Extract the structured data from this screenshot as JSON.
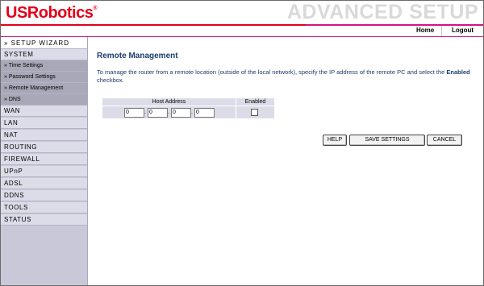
{
  "header": {
    "logo_text": "USRobotics",
    "logo_mark": "®",
    "banner": "ADVANCED SETUP",
    "accent_red": "#e3001b",
    "accent_magenta": "#d8127e"
  },
  "topnav": {
    "home": "Home",
    "logout": "Logout"
  },
  "sidebar": {
    "items": [
      {
        "label": "» SETUP WIZARD",
        "kind": "wizard"
      },
      {
        "label": "SYSTEM",
        "kind": "section"
      },
      {
        "label": "» Time Settings",
        "kind": "sub"
      },
      {
        "label": "» Password Settings",
        "kind": "sub"
      },
      {
        "label": "» Remote Management",
        "kind": "sub"
      },
      {
        "label": "» DNS",
        "kind": "sub"
      },
      {
        "label": "WAN",
        "kind": "section"
      },
      {
        "label": "LAN",
        "kind": "section"
      },
      {
        "label": "NAT",
        "kind": "section"
      },
      {
        "label": "ROUTING",
        "kind": "section"
      },
      {
        "label": "FIREWALL",
        "kind": "section"
      },
      {
        "label": "UPnP",
        "kind": "section"
      },
      {
        "label": "ADSL",
        "kind": "section"
      },
      {
        "label": "DDNS",
        "kind": "section"
      },
      {
        "label": "TOOLS",
        "kind": "section"
      },
      {
        "label": "STATUS",
        "kind": "section"
      }
    ]
  },
  "main": {
    "title": "Remote Management",
    "description_pre": "To manage the router from a remote location (outside of the local network), specify the IP address of the remote PC and select the ",
    "description_bold": "Enabled",
    "description_post": " checkbox.",
    "table": {
      "col_host": "Host Address",
      "col_enabled": "Enabled",
      "ip": [
        "0",
        "0",
        "0",
        "0"
      ],
      "ip_separator": ".",
      "enabled": false
    },
    "buttons": {
      "help": "HELP",
      "save": "SAVE SETTINGS",
      "cancel": "CANCEL"
    }
  }
}
